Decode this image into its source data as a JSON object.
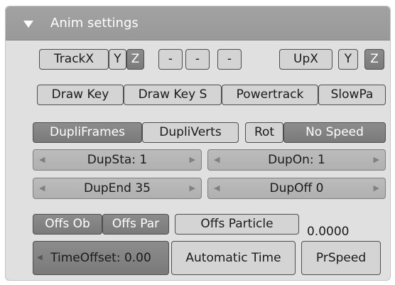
{
  "panel": {
    "title": "Anim settings"
  },
  "row1": {
    "trackx": "TrackX",
    "y": "Y",
    "z": "Z",
    "dash1": "-",
    "dash2": "-",
    "dash3": "-",
    "upx": "UpX",
    "upy": "Y",
    "upz": "Z"
  },
  "row2": {
    "draw_key": "Draw Key",
    "draw_key_s": "Draw Key S",
    "powertrack": "Powertrack",
    "slowpa": "SlowPa"
  },
  "row3": {
    "dupliframes": "DupliFrames",
    "dupliverts": "DupliVerts",
    "rot": "Rot",
    "no_speed": "No Speed"
  },
  "fields": {
    "dupsta": "DupSta: 1",
    "dupon": "DupOn: 1",
    "dupend": "DupEnd 35",
    "dupoff": "DupOff 0"
  },
  "offs": {
    "offs_ob": "Offs Ob",
    "offs_par": "Offs Par",
    "offs_particle": "Offs Particle",
    "value": "0.0000"
  },
  "bottom": {
    "timeoffset": "TimeOffset: 0.00",
    "automatic_time": "Automatic Time",
    "prspeed": "PrSpeed"
  }
}
